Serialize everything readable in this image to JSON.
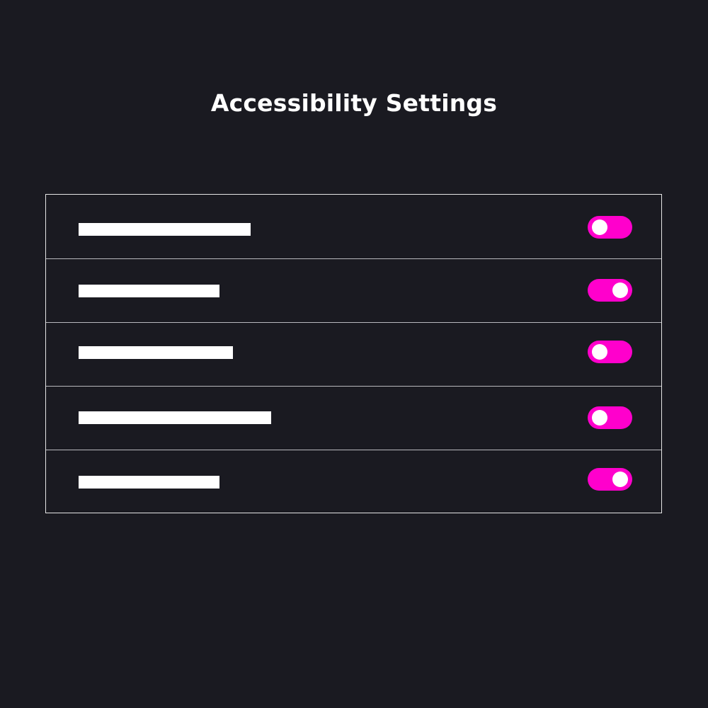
{
  "page": {
    "title": "Accessibility Settings"
  },
  "colors": {
    "background": "#1a1a21",
    "panel_border": "#e6e6e6",
    "divider": "#b9b9be",
    "toggle_accent": "#ff00cc",
    "label_placeholder": "#ffffff",
    "knob": "#ffffff"
  },
  "settings": {
    "items": [
      {
        "label": "",
        "toggle_state": "off"
      },
      {
        "label": "",
        "toggle_state": "on"
      },
      {
        "label": "",
        "toggle_state": "off"
      },
      {
        "label": "",
        "toggle_state": "off"
      },
      {
        "label": "",
        "toggle_state": "on"
      }
    ]
  }
}
